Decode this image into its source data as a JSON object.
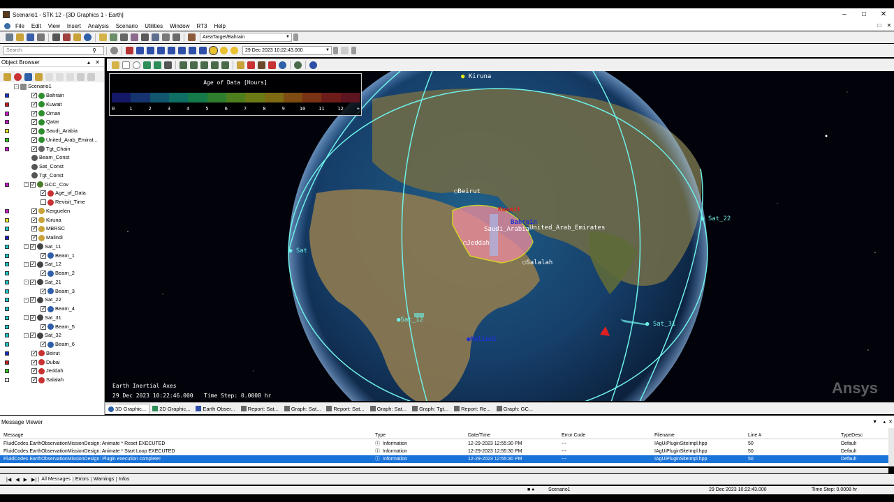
{
  "window": {
    "title": "Scenario1 - STK 12 - [3D Graphics 1 - Earth]",
    "min": "–",
    "max": "□",
    "close": "✕"
  },
  "menu": [
    "File",
    "Edit",
    "View",
    "Insert",
    "Analysis",
    "Scenario",
    "Utilities",
    "Window",
    "RT3",
    "Help"
  ],
  "toolbar": {
    "object_combo": "AreaTarget/Bahrain",
    "time_field": "29 Dec 2023 10:22:43.000"
  },
  "object_browser": {
    "title": "Object Browser",
    "search_placeholder": "Search",
    "root": "Scenario1",
    "items": [
      {
        "label": "Bahrain",
        "color": "#1a2ec8",
        "icon": "area-target-icon"
      },
      {
        "label": "Kuwait",
        "color": "#c81a1a",
        "icon": "area-target-icon"
      },
      {
        "label": "Oman",
        "color": "#c81ac8",
        "icon": "area-target-icon"
      },
      {
        "label": "Qatar",
        "color": "#c81ac8",
        "icon": "area-target-icon"
      },
      {
        "label": "Saudi_Arabia",
        "color": "#e8e81a",
        "icon": "area-target-icon"
      },
      {
        "label": "United_Arab_Emirat...",
        "color": "#2ec81a",
        "icon": "area-target-icon"
      },
      {
        "label": "Tgt_Chain",
        "color": "#c81ac8",
        "icon": "chain-icon"
      },
      {
        "label": "Beam_Const",
        "color": "",
        "icon": "constellation-icon"
      },
      {
        "label": "Sat_Const",
        "color": "",
        "icon": "constellation-icon"
      },
      {
        "label": "Tgt_Const",
        "color": "",
        "icon": "constellation-icon"
      },
      {
        "label": "GCC_Cov",
        "color": "#c81ac8",
        "icon": "coverage-icon"
      },
      {
        "label": "Age_of_Data",
        "color": "",
        "icon": "figure-of-merit-icon"
      },
      {
        "label": "Revisit_Time",
        "color": "",
        "icon": "figure-of-merit-icon"
      },
      {
        "label": "Kerguelen",
        "color": "#c81ac8",
        "icon": "facility-icon"
      },
      {
        "label": "Kiruna",
        "color": "#e8e81a",
        "icon": "facility-icon"
      },
      {
        "label": "MBRSC",
        "color": "#1ac8c8",
        "icon": "facility-icon"
      },
      {
        "label": "Malindi",
        "color": "#1a1ac8",
        "icon": "facility-icon"
      },
      {
        "label": "Sat_11",
        "color": "#1ac8c8",
        "icon": "satellite-icon"
      },
      {
        "label": "Beam_1",
        "color": "#1ac8c8",
        "icon": "sensor-icon"
      },
      {
        "label": "Sat_12",
        "color": "#1ac8c8",
        "icon": "satellite-icon"
      },
      {
        "label": "Beam_2",
        "color": "#1ac8c8",
        "icon": "sensor-icon"
      },
      {
        "label": "Sat_21",
        "color": "#1ac8c8",
        "icon": "satellite-icon"
      },
      {
        "label": "Beam_3",
        "color": "#1ac8c8",
        "icon": "sensor-icon"
      },
      {
        "label": "Sat_22",
        "color": "#1ac8c8",
        "icon": "satellite-icon"
      },
      {
        "label": "Beam_4",
        "color": "#1ac8c8",
        "icon": "sensor-icon"
      },
      {
        "label": "Sat_31",
        "color": "#1ac8c8",
        "icon": "satellite-icon"
      },
      {
        "label": "Beam_5",
        "color": "#1ac8c8",
        "icon": "sensor-icon"
      },
      {
        "label": "Sat_32",
        "color": "#1ac8c8",
        "icon": "satellite-icon"
      },
      {
        "label": "Beam_6",
        "color": "#1ac8c8",
        "icon": "sensor-icon"
      },
      {
        "label": "Beirut",
        "color": "#1a2ec8",
        "icon": "target-icon"
      },
      {
        "label": "Dubai",
        "color": "#c81a1a",
        "icon": "target-icon"
      },
      {
        "label": "Jeddah",
        "color": "#2ec81a",
        "icon": "target-icon"
      },
      {
        "label": "Salalah",
        "color": "#ffffff",
        "icon": "target-icon"
      }
    ]
  },
  "legend": {
    "title": "Age of Data [Hours]",
    "ticks": [
      "0",
      "1",
      "2",
      "3",
      "4",
      "5",
      "6",
      "7",
      "8",
      "9",
      "10",
      "11",
      "12",
      "+"
    ],
    "colors": [
      "#141866",
      "#15336e",
      "#11566e",
      "#0f6e64",
      "#157a4a",
      "#2e7e2e",
      "#4c7e1e",
      "#6c7a16",
      "#7e6a12",
      "#7e4c12",
      "#7a3214",
      "#6e1c1a",
      "#5c1420"
    ]
  },
  "viewport_labels": {
    "kiruna": "Kiruna",
    "beirut": "Beirut",
    "kuwait": "Kuwait",
    "bahrain": "Bahrain",
    "saudi": "Saudi_Arabia",
    "uae": "United_Arab_Emirates",
    "jeddah": "Jeddah",
    "salalah": "Salalah",
    "sat22": "Sat_22",
    "sat12": "Sat_12",
    "sat31": "Sat_31",
    "sat_left": "Sat",
    "malindi": "Malindi",
    "axes": "Earth Inertial Axes",
    "time": "29 Dec 2023 10:22:46.000",
    "timestep": "Time Step: 0.0008 hr",
    "watermark": "Ansys"
  },
  "tabs": [
    "3D Graphic...",
    "2D Graphic...",
    "Earth Obser...",
    "Report: Sat...",
    "Graph: Sat...",
    "Report: Sat...",
    "Graph: Sat...",
    "Graph: Tgt...",
    "Report: Re...",
    "Graph: GC..."
  ],
  "message_viewer": {
    "title": "Message Viewer",
    "columns": [
      "Message",
      "Type",
      "Date/Time",
      "Error Code",
      "Filename",
      "Line #",
      "TypeDesc"
    ],
    "rows": [
      [
        "FluidCodes.EarthObservationMissionDesign: Animate * Reset EXECUTED",
        "Information",
        "12-29-2023 12:55:30 PM",
        "---",
        "IAgUiPluginSiteImpl.hpp",
        "50",
        "Default"
      ],
      [
        "FluidCodes.EarthObservationMissionDesign: Animate * Start Loop EXECUTED",
        "Information",
        "12-29-2023 12:55:30 PM",
        "---",
        "IAgUiPluginSiteImpl.hpp",
        "50",
        "Default"
      ],
      [
        "FluidCodes.EarthObservationMissionDesign: Plugin execution complete!",
        "Information",
        "12-29-2023 12:55:30 PM",
        "---",
        "IAgUiPluginSiteImpl.hpp",
        "50",
        "Default"
      ]
    ],
    "filter_tabs": [
      "All Messages",
      "Errors",
      "Warnings",
      "Infos"
    ]
  },
  "status": {
    "scenario": "Scenario1",
    "time": "29 Dec 2023 10:22:43.000",
    "timestep": "Time Step: 0.0008 hr"
  }
}
